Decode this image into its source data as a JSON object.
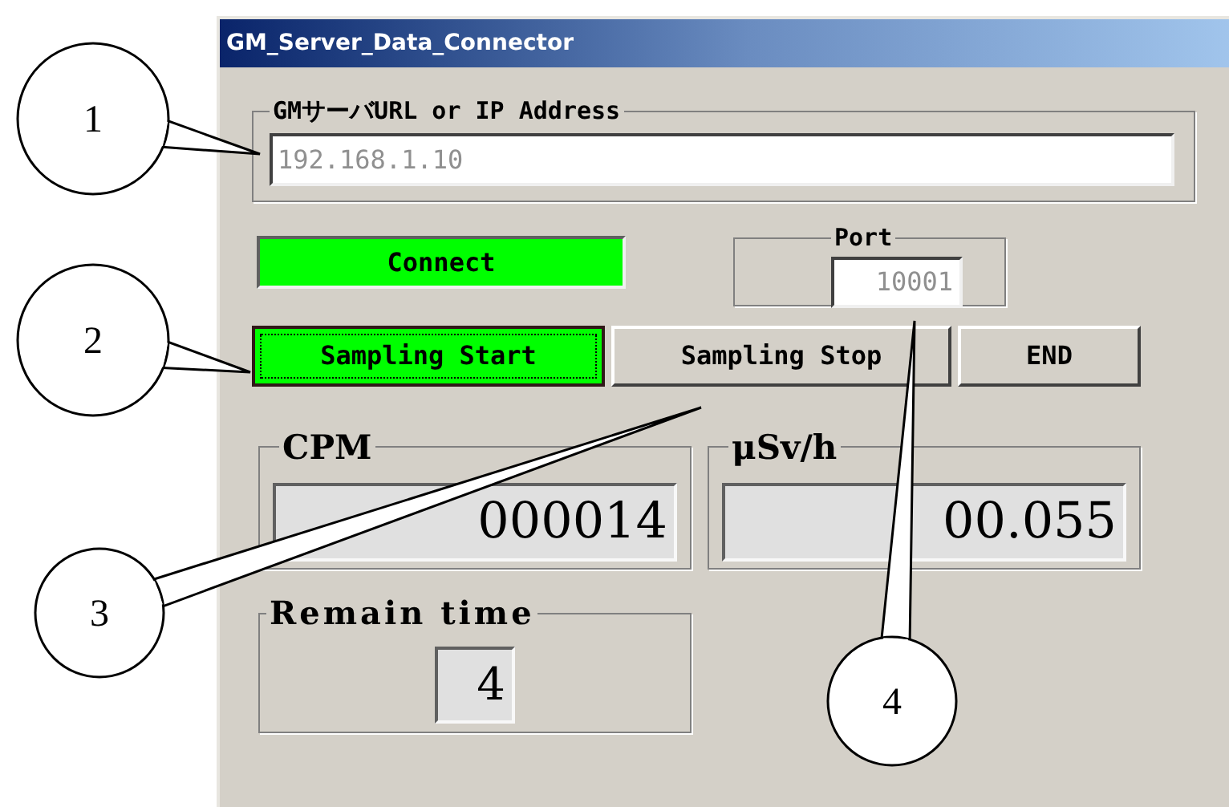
{
  "window": {
    "title": "GM_Server_Data_Connector"
  },
  "server": {
    "label": "GMサーバURL or IP Address",
    "value": "192.168.1.10"
  },
  "connect_indicator": {
    "label": "Connect",
    "on": true
  },
  "port": {
    "label": "Port",
    "value": "10001"
  },
  "buttons": [
    {
      "label": "Sampling Start",
      "active": true
    },
    {
      "label": "Sampling Stop",
      "active": false
    },
    {
      "label": "END",
      "active": false
    }
  ],
  "readouts": [
    {
      "label": "CPM",
      "value": "000014"
    },
    {
      "label": "μSv/h",
      "value": "00.055"
    }
  ],
  "remain_time": {
    "label": "Remain time",
    "value": "4"
  },
  "callouts": [
    {
      "number": "1"
    },
    {
      "number": "2"
    },
    {
      "number": "3"
    },
    {
      "number": "4"
    }
  ]
}
